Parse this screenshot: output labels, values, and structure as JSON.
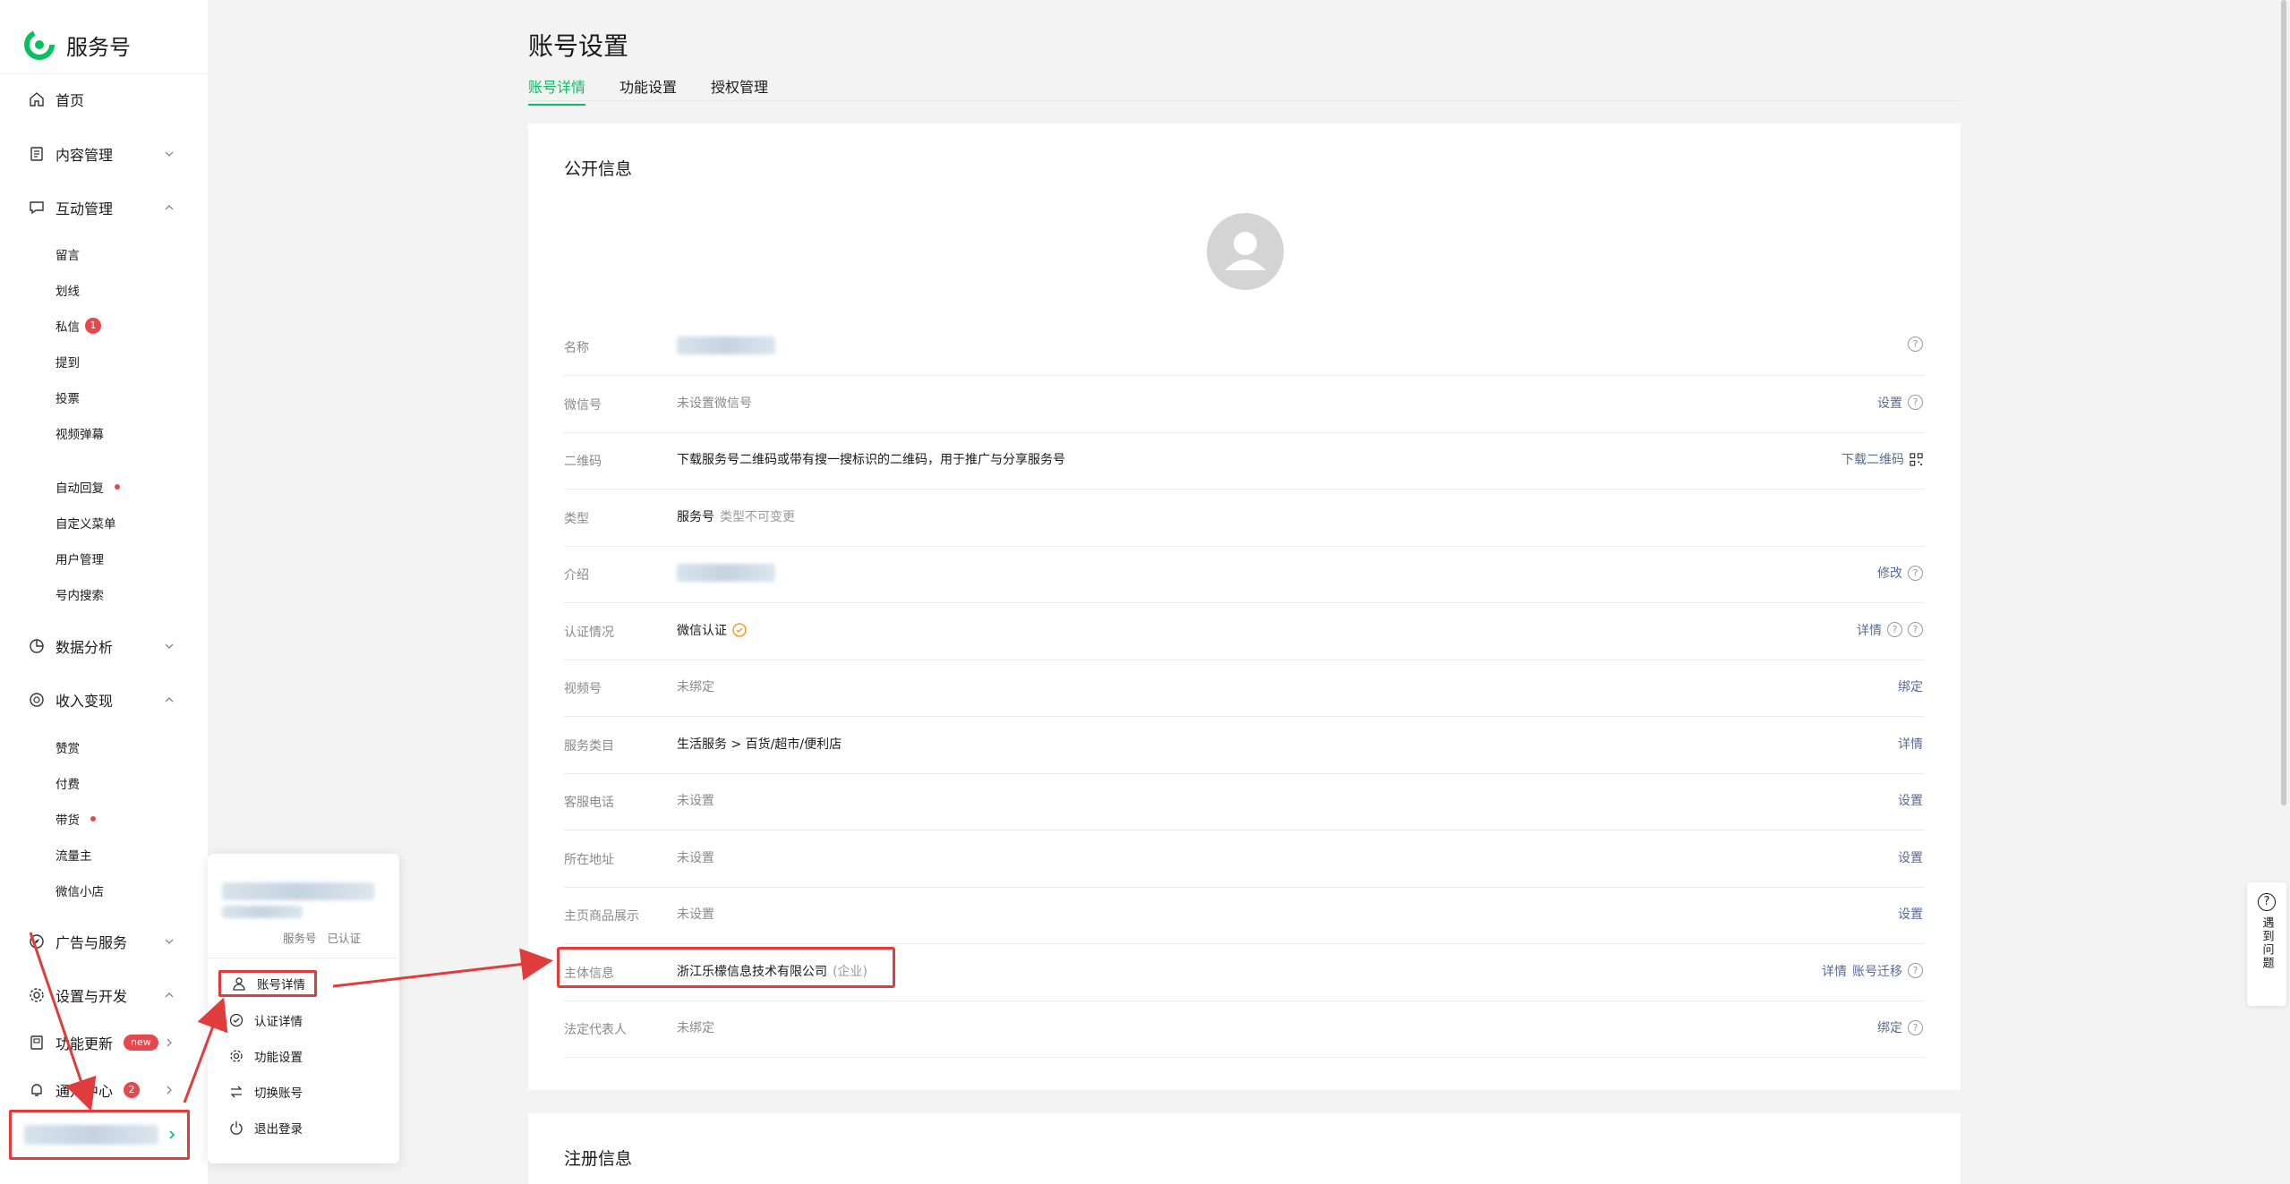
{
  "brand": {
    "name": "服务号",
    "accent": "#07c160"
  },
  "sidebar": {
    "items": [
      {
        "label": "首页",
        "icon": "home-icon"
      },
      {
        "label": "内容管理",
        "icon": "document-icon",
        "expanded": false
      },
      {
        "label": "互动管理",
        "icon": "chat-icon",
        "expanded": true
      },
      {
        "label": "数据分析",
        "icon": "chart-icon",
        "expanded": false
      },
      {
        "label": "收入变现",
        "icon": "coin-icon",
        "expanded": true
      },
      {
        "label": "广告与服务",
        "icon": "compass-icon",
        "expanded": false
      },
      {
        "label": "设置与开发",
        "icon": "gear-icon",
        "expanded": true
      },
      {
        "label": "功能更新",
        "icon": "book-icon",
        "badge": "new"
      },
      {
        "label": "通知中心",
        "icon": "bell-icon",
        "badge": "2"
      }
    ],
    "interaction_subitems": [
      {
        "label": "留言"
      },
      {
        "label": "划线"
      },
      {
        "label": "私信",
        "badge": "1"
      },
      {
        "label": "提到"
      },
      {
        "label": "投票"
      },
      {
        "label": "视频弹幕"
      },
      {
        "label": "自动回复",
        "dot": true
      },
      {
        "label": "自定义菜单"
      },
      {
        "label": "用户管理"
      },
      {
        "label": "号内搜索"
      }
    ],
    "income_subitems": [
      {
        "label": "赞赏"
      },
      {
        "label": "付费"
      },
      {
        "label": "带货",
        "dot": true
      },
      {
        "label": "流量主"
      },
      {
        "label": "微信小店"
      }
    ]
  },
  "popup": {
    "type_label": "服务号",
    "verified_label": "已认证",
    "items": [
      {
        "label": "账号详情",
        "icon": "user-icon"
      },
      {
        "label": "认证详情",
        "icon": "check-circle-icon"
      },
      {
        "label": "功能设置",
        "icon": "gear-icon"
      },
      {
        "label": "切换账号",
        "icon": "switch-icon"
      },
      {
        "label": "退出登录",
        "icon": "power-icon"
      }
    ]
  },
  "page": {
    "title": "账号设置",
    "tabs": [
      {
        "label": "账号详情",
        "active": true
      },
      {
        "label": "功能设置",
        "active": false
      },
      {
        "label": "授权管理",
        "active": false
      }
    ]
  },
  "public_info": {
    "title": "公开信息",
    "rows": [
      {
        "label": "名称",
        "value": "",
        "blurred": true,
        "actions": [],
        "help": 1
      },
      {
        "label": "微信号",
        "value": "未设置微信号",
        "muted": true,
        "actions": [
          "设置"
        ],
        "help": 1
      },
      {
        "label": "二维码",
        "value": "下载服务号二维码或带有搜一搜标识的二维码，用于推广与分享服务号",
        "actions": [
          "下载二维码"
        ],
        "qr": true
      },
      {
        "label": "类型",
        "value": "服务号",
        "sub": "类型不可变更",
        "actions": []
      },
      {
        "label": "介绍",
        "value": "",
        "blurred": true,
        "actions": [
          "修改"
        ],
        "help": 1
      },
      {
        "label": "认证情况",
        "value": "微信认证",
        "verified": true,
        "actions": [
          "详情"
        ],
        "help": 2
      },
      {
        "label": "视频号",
        "value": "未绑定",
        "muted": true,
        "actions": [
          "绑定"
        ]
      },
      {
        "label": "服务类目",
        "value": "生活服务 > 百货/超市/便利店",
        "actions": [
          "详情"
        ]
      },
      {
        "label": "客服电话",
        "value": "未设置",
        "muted": true,
        "actions": [
          "设置"
        ]
      },
      {
        "label": "所在地址",
        "value": "未设置",
        "muted": true,
        "actions": [
          "设置"
        ]
      },
      {
        "label": "主页商品展示",
        "value": "未设置",
        "muted": true,
        "actions": [
          "设置"
        ]
      },
      {
        "label": "主体信息",
        "value": "浙江乐檬信息技术有限公司",
        "sub": "(企业)",
        "actions": [
          "详情",
          "账号迁移"
        ],
        "help": 1
      },
      {
        "label": "法定代表人",
        "value": "未绑定",
        "muted": true,
        "actions": [
          "绑定"
        ],
        "help": 1
      }
    ]
  },
  "registration_info": {
    "title": "注册信息"
  },
  "help_float": {
    "label": "遇到问题"
  },
  "colors": {
    "link": "#576b95",
    "annotation": "#e03c3c",
    "badge": "#e5484d"
  }
}
